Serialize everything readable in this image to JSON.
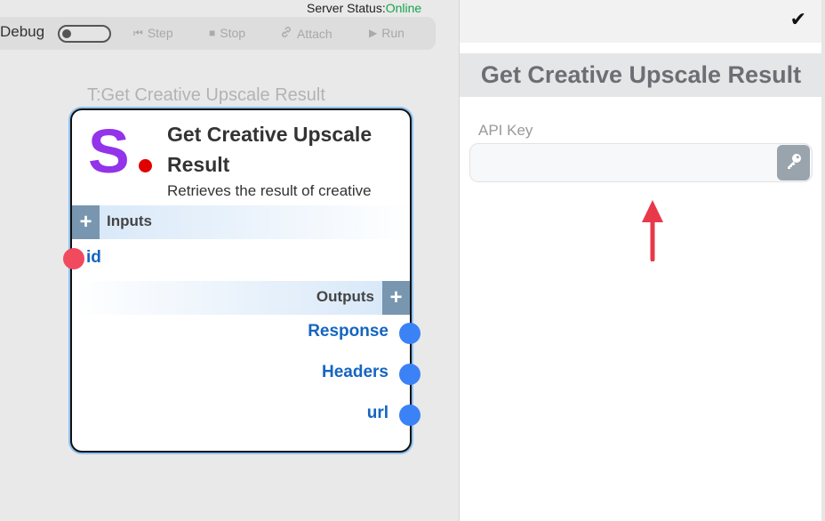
{
  "server": {
    "label": "Server Status:",
    "status": "Online",
    "status_color": "#16a34a"
  },
  "toolbar": {
    "debug_label": "Debug",
    "debug_on": false,
    "buttons": [
      {
        "label": "Step",
        "icon": "step-icon"
      },
      {
        "label": "Stop",
        "icon": "stop-icon"
      },
      {
        "label": "Attach",
        "icon": "link-icon"
      },
      {
        "label": "Run",
        "icon": "play-icon"
      }
    ]
  },
  "node": {
    "caption": "T:Get Creative Upscale Result",
    "logo_letter": "S",
    "logo_color": "#9333ea",
    "title": "Get Creative Upscale Result",
    "description": "Retrieves the result of creative upscale...",
    "inputs_label": "Inputs",
    "outputs_label": "Outputs",
    "inputs": [
      {
        "label": "id"
      }
    ],
    "outputs": [
      {
        "label": "Response"
      },
      {
        "label": "Headers"
      },
      {
        "label": "url"
      }
    ]
  },
  "panel": {
    "title": "Get Creative Upscale Result",
    "api_key_label": "API Key",
    "api_key_value": "",
    "confirm_icon": "check-icon",
    "key_icon": "key-icon"
  },
  "colors": {
    "accent_blue": "#1565c0",
    "port_output": "#3b82f6",
    "port_input": "#f14a5f",
    "arrow": "#e8394a"
  }
}
